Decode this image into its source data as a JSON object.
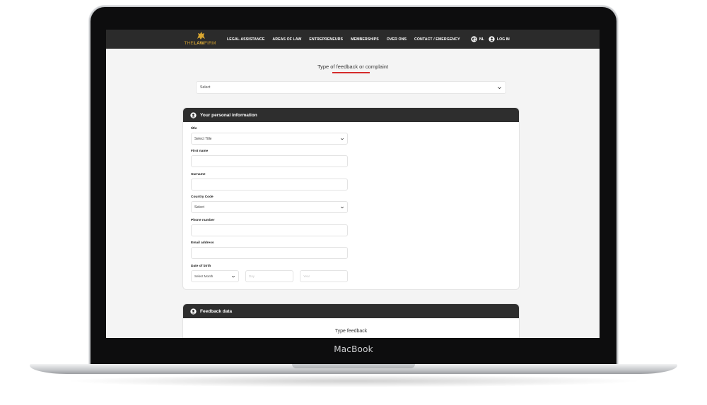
{
  "device": {
    "label": "MacBook"
  },
  "nav": {
    "logo": {
      "part1": "THE",
      "part2": "LAW",
      "part3": "FIRM"
    },
    "links": [
      "LEGAL ASSISTANCE",
      "AREAS OF LAW",
      "ENTREPRENEURS",
      "MEMBERSHIPS",
      "OVER ONS",
      "CONTACT / EMERGENCY"
    ],
    "lang": "NL",
    "login": "LOG IN"
  },
  "feedback_type": {
    "title": "Type of feedback or complaint",
    "select_value": "Select"
  },
  "personal": {
    "title": "Your personal information",
    "fields": {
      "title_label": "title",
      "title_value": "Select Title",
      "first_name_label": "First name",
      "surname_label": "Surname",
      "country_code_label": "Country Code",
      "country_code_value": "Select",
      "phone_label": "Phone number",
      "email_label": "Email address",
      "dob_label": "Date of birth",
      "dob_month": "Select Month",
      "dob_day_placeholder": "Day",
      "dob_year_placeholder": "Year"
    }
  },
  "feedback_data": {
    "title": "Feedback data",
    "type_label": "Type feedback"
  },
  "colors": {
    "nav_bg": "#2b2b2b",
    "accent_gold": "#e7b43a",
    "underline_red": "#d52b2b",
    "card_header": "#2e2e2e"
  }
}
